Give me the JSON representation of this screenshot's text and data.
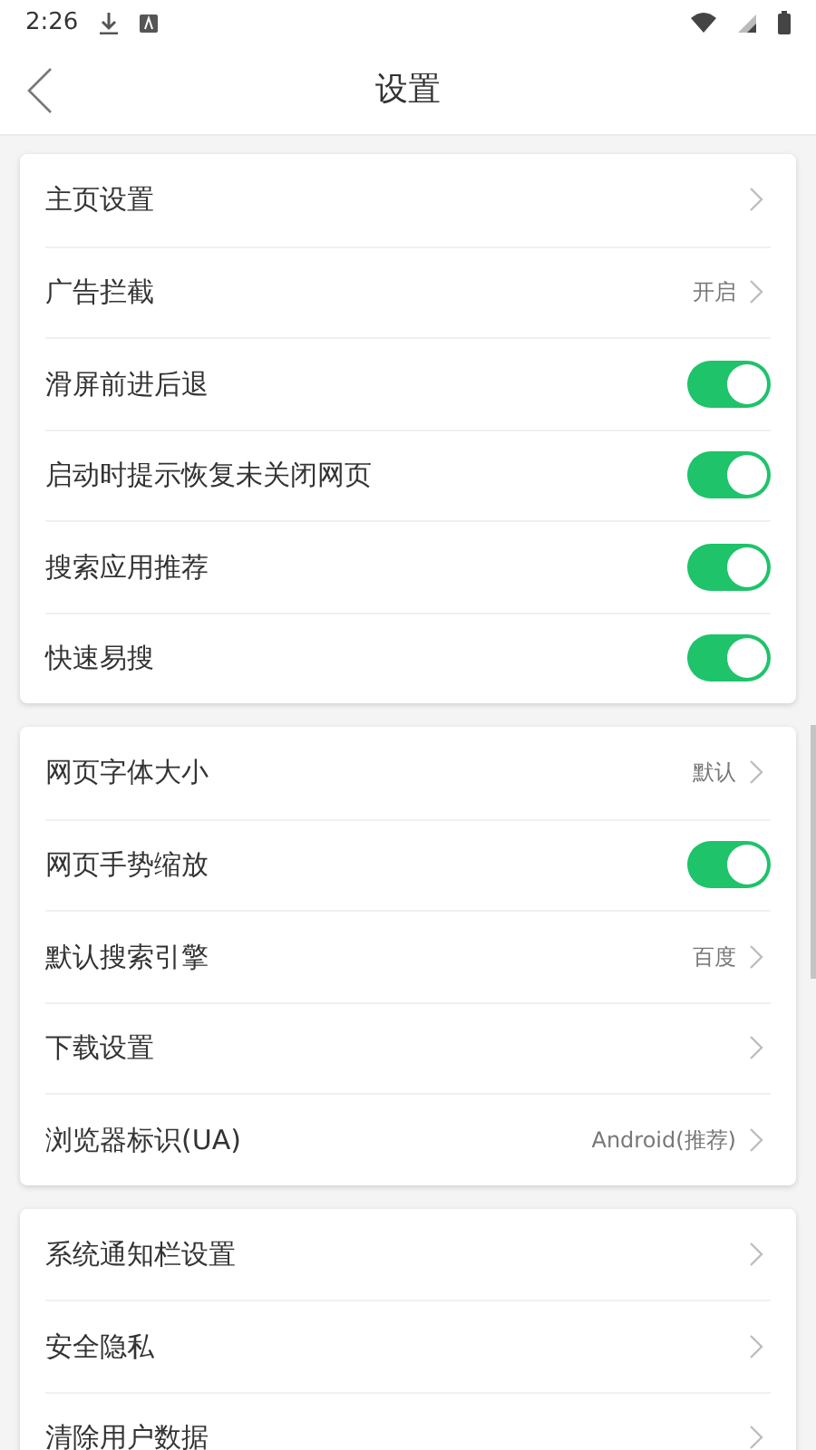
{
  "status_bar": {
    "time": "2:26"
  },
  "header": {
    "title": "设置"
  },
  "groups": [
    {
      "rows": [
        {
          "kind": "link",
          "label": "主页设置"
        },
        {
          "kind": "link",
          "label": "广告拦截",
          "value": "开启"
        },
        {
          "kind": "toggle",
          "label": "滑屏前进后退",
          "on": true
        },
        {
          "kind": "toggle",
          "label": "启动时提示恢复未关闭网页",
          "on": true
        },
        {
          "kind": "toggle",
          "label": "搜索应用推荐",
          "on": true
        },
        {
          "kind": "toggle",
          "label": "快速易搜",
          "on": true
        }
      ]
    },
    {
      "rows": [
        {
          "kind": "link",
          "label": "网页字体大小",
          "value": "默认"
        },
        {
          "kind": "toggle",
          "label": "网页手势缩放",
          "on": true
        },
        {
          "kind": "link",
          "label": "默认搜索引擎",
          "value": "百度"
        },
        {
          "kind": "link",
          "label": "下载设置"
        },
        {
          "kind": "link",
          "label": "浏览器标识(UA)",
          "value": "Android(推荐)"
        }
      ]
    },
    {
      "rows": [
        {
          "kind": "link",
          "label": "系统通知栏设置"
        },
        {
          "kind": "link",
          "label": "安全隐私"
        },
        {
          "kind": "link",
          "label": "清除用户数据"
        }
      ]
    }
  ]
}
